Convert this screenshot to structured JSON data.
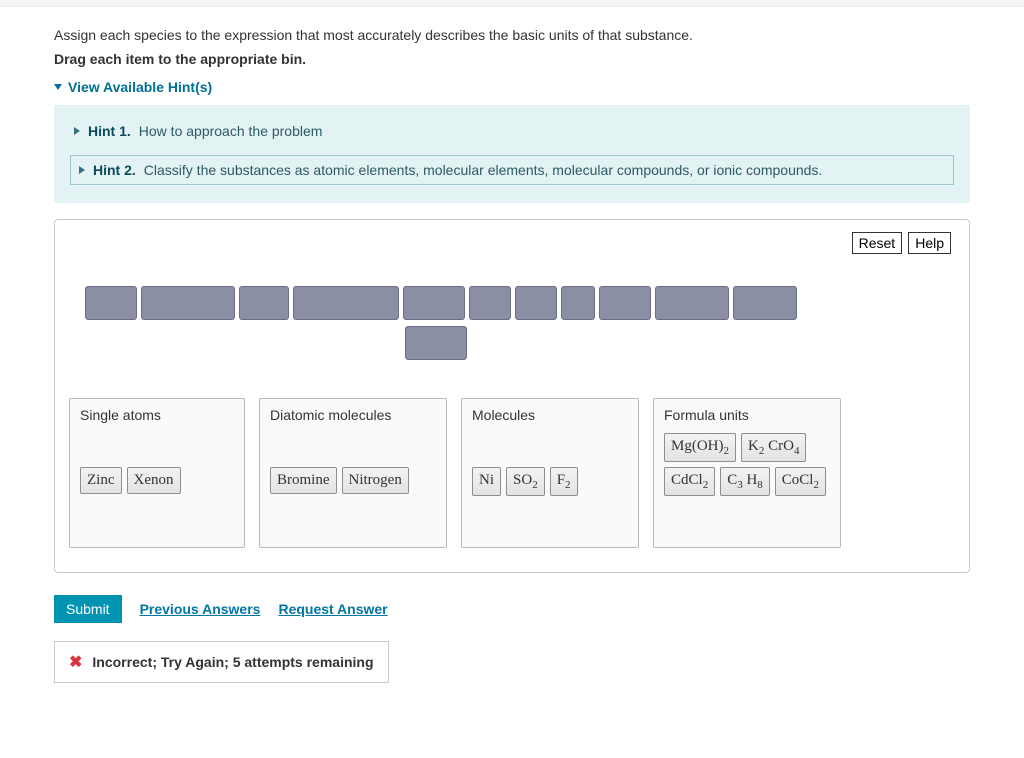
{
  "question": "Assign each species to the expression that most accurately describes the basic units of that substance.",
  "instruction": "Drag each item to the appropriate bin.",
  "hints_toggle": "View Available Hint(s)",
  "hints": {
    "h1_label": "Hint 1.",
    "h1_text": "How to approach the problem",
    "h2_label": "Hint 2.",
    "h2_text": "Classify the substances as atomic elements, molecular elements, molecular compounds, or ionic compounds."
  },
  "buttons": {
    "reset": "Reset",
    "help": "Help",
    "submit": "Submit"
  },
  "links": {
    "previous": "Previous Answers",
    "request": "Request Answer"
  },
  "pool_widths_row1": [
    50,
    92,
    48,
    104,
    60,
    40,
    40,
    32,
    50,
    72,
    62
  ],
  "pool_widths_row2": [
    60
  ],
  "bins": [
    {
      "title": "Single atoms",
      "items": [
        {
          "parts": [
            {
              "t": "Zinc"
            }
          ]
        },
        {
          "parts": [
            {
              "t": "Xenon"
            }
          ]
        }
      ]
    },
    {
      "title": "Diatomic molecules",
      "items": [
        {
          "parts": [
            {
              "t": "Bromine"
            }
          ]
        },
        {
          "parts": [
            {
              "t": "Nitrogen"
            }
          ]
        }
      ]
    },
    {
      "title": "Molecules",
      "items": [
        {
          "parts": [
            {
              "t": "Ni"
            }
          ]
        },
        {
          "parts": [
            {
              "t": "SO"
            },
            {
              "t": "2",
              "sub": true
            }
          ]
        },
        {
          "parts": [
            {
              "t": "F"
            },
            {
              "t": "2",
              "sub": true
            }
          ]
        }
      ]
    },
    {
      "title": "Formula units",
      "items": [
        {
          "parts": [
            {
              "t": "Mg(OH)"
            },
            {
              "t": "2",
              "sub": true
            }
          ]
        },
        {
          "parts": [
            {
              "t": "K"
            },
            {
              "t": "2",
              "sub": true
            },
            {
              "t": " CrO"
            },
            {
              "t": "4",
              "sub": true
            }
          ]
        },
        {
          "parts": [
            {
              "t": "CdCl"
            },
            {
              "t": "2",
              "sub": true
            }
          ]
        },
        {
          "parts": [
            {
              "t": "C"
            },
            {
              "t": "3",
              "sub": true
            },
            {
              "t": " H"
            },
            {
              "t": "8",
              "sub": true
            }
          ]
        },
        {
          "parts": [
            {
              "t": "CoCl"
            },
            {
              "t": "2",
              "sub": true
            }
          ]
        }
      ]
    }
  ],
  "feedback": "Incorrect; Try Again; 5 attempts remaining"
}
